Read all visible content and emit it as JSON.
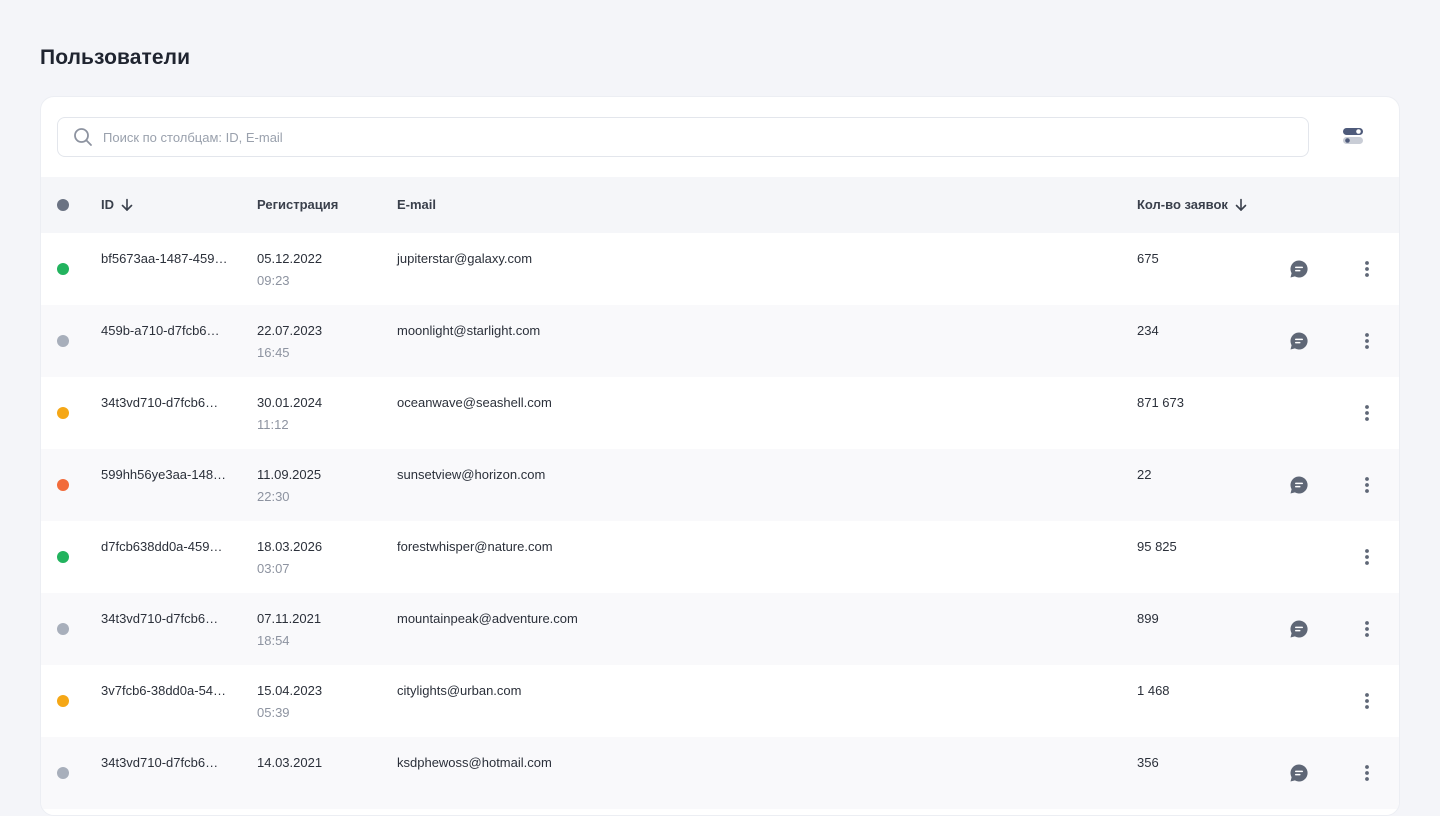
{
  "page": {
    "title": "Пользователи"
  },
  "search": {
    "placeholder": "Поиск по столбцам: ID, E-mail"
  },
  "colors": {
    "active": "#22b35e",
    "inactive": "#a8afbb",
    "pending": "#f5a716",
    "blocked": "#f26b3a",
    "header_dot": "#6b7383",
    "icon": "#5f6776"
  },
  "table": {
    "columns": {
      "id": "ID",
      "registration": "Регистрация",
      "email": "E-mail",
      "requests": "Кол-во заявок"
    },
    "rows": [
      {
        "status": "active",
        "id": "bf5673aa-1487-459…",
        "date": "05.12.2022",
        "time": "09:23",
        "email": "jupiterstar@galaxy.com",
        "count": "675",
        "chat": true
      },
      {
        "status": "inactive",
        "id": "459b-a710-d7fcb6…",
        "date": "22.07.2023",
        "time": "16:45",
        "email": "moonlight@starlight.com",
        "count": "234",
        "chat": true
      },
      {
        "status": "pending",
        "id": "34t3vd710-d7fcb6…",
        "date": "30.01.2024",
        "time": "11:12",
        "email": "oceanwave@seashell.com",
        "count": "871 673",
        "chat": false
      },
      {
        "status": "blocked",
        "id": "599hh56ye3aa-148…",
        "date": "11.09.2025",
        "time": "22:30",
        "email": "sunsetview@horizon.com",
        "count": "22",
        "chat": true
      },
      {
        "status": "active",
        "id": "d7fcb638dd0a-459…",
        "date": "18.03.2026",
        "time": "03:07",
        "email": "forestwhisper@nature.com",
        "count": "95 825",
        "chat": false
      },
      {
        "status": "inactive",
        "id": "34t3vd710-d7fcb6…",
        "date": "07.11.2021",
        "time": "18:54",
        "email": "mountainpeak@adventure.com",
        "count": "899",
        "chat": true
      },
      {
        "status": "pending",
        "id": "3v7fcb6-38dd0a-54…",
        "date": "15.04.2023",
        "time": "05:39",
        "email": "citylights@urban.com",
        "count": "1 468",
        "chat": false
      },
      {
        "status": "inactive",
        "id": "34t3vd710-d7fcb6…",
        "date": "14.03.2021",
        "time": "",
        "email": "ksdphewoss@hotmail.com",
        "count": "356",
        "chat": true
      }
    ]
  }
}
